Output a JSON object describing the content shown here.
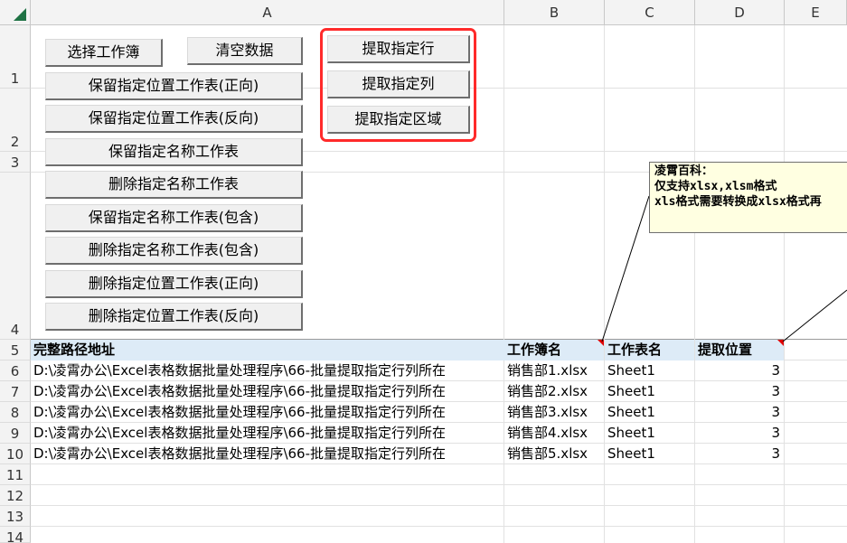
{
  "columns": [
    "A",
    "B",
    "C",
    "D",
    "E"
  ],
  "rows": [
    "1",
    "2",
    "3",
    "4",
    "5",
    "6",
    "7",
    "8",
    "9",
    "10",
    "11",
    "12",
    "13",
    "14"
  ],
  "buttons_left": [
    "选择工作簿",
    "清空数据",
    "保留指定位置工作表(正向)",
    "保留指定位置工作表(反向)",
    "保留指定名称工作表",
    "删除指定名称工作表",
    "保留指定名称工作表(包含)",
    "删除指定名称工作表(包含)",
    "删除指定位置工作表(正向)",
    "删除指定位置工作表(反向)"
  ],
  "buttons_extract": [
    "提取指定行",
    "提取指定列",
    "提取指定区域"
  ],
  "table": {
    "headers": [
      "完整路径地址",
      "工作簿名",
      "工作表名",
      "提取位置"
    ],
    "rows": [
      {
        "path": "D:\\凌霄办公\\Excel表格数据批量处理程序\\66-批量提取指定行列所在",
        "book": "销售部1.xlsx",
        "sheet": "Sheet1",
        "pos": "3"
      },
      {
        "path": "D:\\凌霄办公\\Excel表格数据批量处理程序\\66-批量提取指定行列所在",
        "book": "销售部2.xlsx",
        "sheet": "Sheet1",
        "pos": "3"
      },
      {
        "path": "D:\\凌霄办公\\Excel表格数据批量处理程序\\66-批量提取指定行列所在",
        "book": "销售部3.xlsx",
        "sheet": "Sheet1",
        "pos": "3"
      },
      {
        "path": "D:\\凌霄办公\\Excel表格数据批量处理程序\\66-批量提取指定行列所在",
        "book": "销售部4.xlsx",
        "sheet": "Sheet1",
        "pos": "3"
      },
      {
        "path": "D:\\凌霄办公\\Excel表格数据批量处理程序\\66-批量提取指定行列所在",
        "book": "销售部5.xlsx",
        "sheet": "Sheet1",
        "pos": "3"
      }
    ]
  },
  "comment": {
    "line1": "凌霄百科：",
    "line2": "仅支持xlsx,xlsm格式",
    "line3": "xls格式需要转换成xlsx格式再"
  },
  "colors": {
    "header_fill": "#ddebf7",
    "highlight_border": "#ff2a2a",
    "comment_fill": "#ffffe1",
    "excel_green": "#1f7244"
  }
}
